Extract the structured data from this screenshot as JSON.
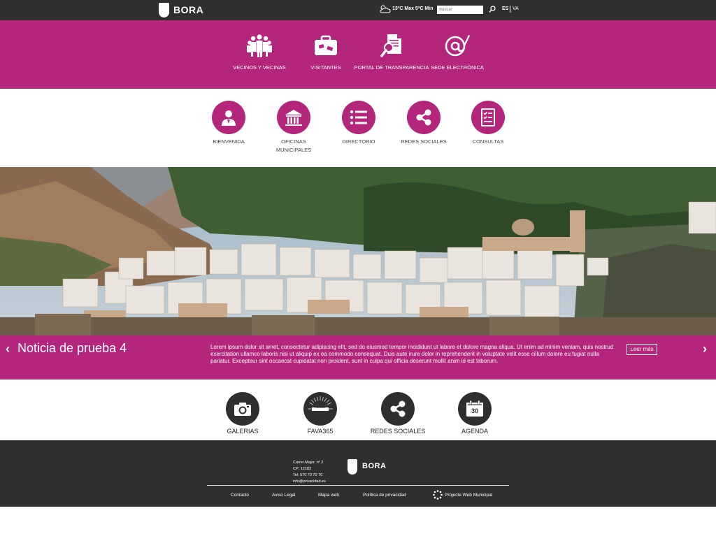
{
  "header": {
    "brand": "BORA",
    "weather": "13ºC Max 5ºC Min",
    "search_placeholder": "Buscar",
    "lang_es": "ES",
    "lang_va": "VA"
  },
  "main_nav": [
    {
      "label": "VECINOS Y VECINAS",
      "icon": "people-icon"
    },
    {
      "label": "VISITANTES",
      "icon": "suitcase-icon"
    },
    {
      "label": "PORTAL DE TRANSPARENCIA",
      "icon": "document-search-icon"
    },
    {
      "label": "SEDE ELECTRÒNICA",
      "icon": "at-sign-icon"
    }
  ],
  "quick_links": [
    {
      "label": "BIENVENIDA",
      "icon": "person-icon"
    },
    {
      "label": "OFICINAS MUNICIPALES",
      "icon": "building-icon"
    },
    {
      "label": "DIRECTORIO",
      "icon": "list-icon"
    },
    {
      "label": "REDES SOCIALES",
      "icon": "share-icon"
    },
    {
      "label": "CONSULTAS",
      "icon": "checklist-icon"
    }
  ],
  "news": {
    "title": "Noticia de prueba 4",
    "text": "Lorem ipsum dolor sit amet, consectetur adipiscing elit, sed do eiusmod tempor incididunt ut labore et dolore magna aliqua. Ut enim ad minim veniam, quis nostrud exercitation ullamco laboris nisi ut aliquip ex ea commodo consequat. Duis aute irure dolor in reprehenderit in voluptate velit esse cillum dolore eu fugiat nulla pariatur. Excepteur sint occaecat cupidatat non proident, sunt in culpa qui officia deserunt mollit anim id est laborum.",
    "read_more": "Leer más"
  },
  "features": [
    {
      "label": "GALERIAS",
      "icon": "camera-icon"
    },
    {
      "label": "FAVA365",
      "icon": "fava365-icon",
      "badge": "FAVA365"
    },
    {
      "label": "REDES SOCIALES",
      "icon": "share-icon"
    },
    {
      "label": "AGENDA",
      "icon": "calendar-icon",
      "day": "30"
    }
  ],
  "footer": {
    "address_1": "Carrer Major, nº 2",
    "address_2": "CP: 12183",
    "address_3": "Tel: 570 70 70 70",
    "address_4": "info@privacidad.es",
    "brand": "BORA",
    "links": [
      "Contacto",
      "Aviso Legal",
      "Mapa web",
      "Política de privacidad"
    ],
    "project": "Projecte Web Municipal"
  },
  "colors": {
    "magenta": "#b3267b",
    "dark": "#2f2f2d"
  }
}
